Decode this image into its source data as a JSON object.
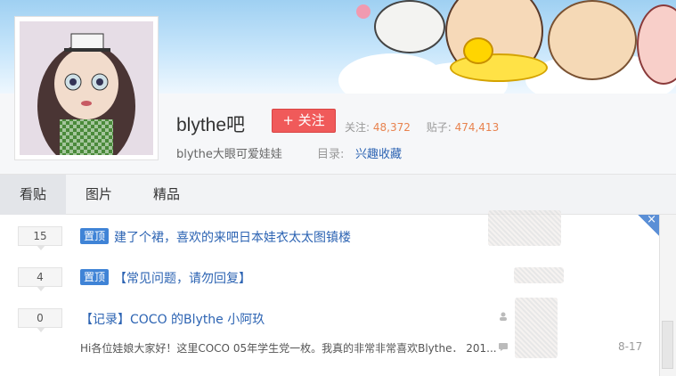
{
  "forum": {
    "name": "blythe吧",
    "follow_label": "+ 关注",
    "followers_label": "关注:",
    "followers_count": "48,372",
    "posts_label": "贴子:",
    "posts_count": "474,413",
    "description": "blythe大眼可爱娃娃",
    "catalog_label": "目录:",
    "catalog_value": "兴趣收藏"
  },
  "tabs": [
    {
      "label": "看贴",
      "active": true
    },
    {
      "label": "图片",
      "active": false
    },
    {
      "label": "精品",
      "active": false
    }
  ],
  "threads": [
    {
      "replies": "15",
      "pinned": true,
      "pin_label": "置顶",
      "title": "建了个裙，喜欢的来吧日本娃衣太太图镇楼"
    },
    {
      "replies": "4",
      "pinned": true,
      "pin_label": "置顶",
      "title": "【常见问题，请勿回复】"
    },
    {
      "replies": "0",
      "pinned": false,
      "title": "【记录】COCO 的Blythe 小阿玖",
      "snippet": "Hi各位娃娘大家好！这里COCO 05年学生党一枚。我真的非常非常喜欢Blythe． 201...",
      "date": "8-17"
    }
  ],
  "close_icon": "×",
  "colors": {
    "follow": "#f05a5a",
    "link": "#2d64b3",
    "pin": "#3f83d6",
    "count": "#e8834f"
  }
}
